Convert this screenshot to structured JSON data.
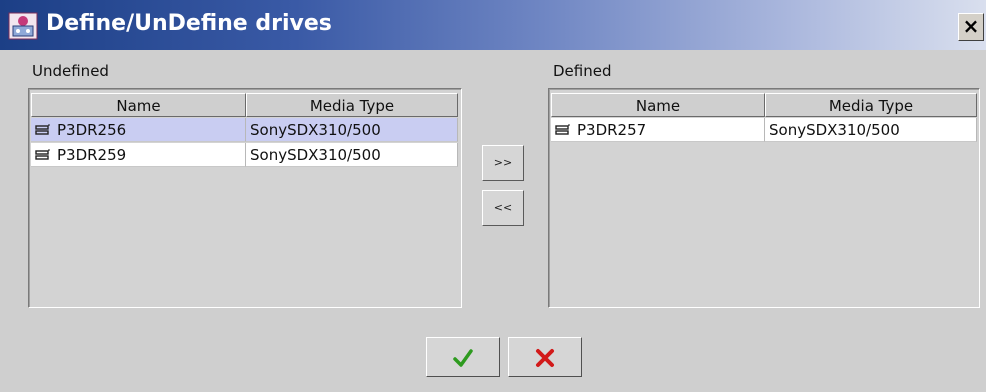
{
  "window": {
    "title": "Define/UnDefine drives",
    "close_label": "×"
  },
  "undefined": {
    "label": "Undefined",
    "columns": [
      "Name",
      "Media Type"
    ],
    "rows": [
      {
        "name": "P3DR256",
        "media": "SonySDX310/500",
        "selected": true,
        "icon": "tape-drive-icon"
      },
      {
        "name": "P3DR259",
        "media": "SonySDX310/500",
        "selected": false,
        "icon": "tape-drive-icon"
      }
    ]
  },
  "defined": {
    "label": "Defined",
    "columns": [
      "Name",
      "Media Type"
    ],
    "rows": [
      {
        "name": "P3DR257",
        "media": "SonySDX310/500",
        "selected": false,
        "icon": "tape-drive-icon"
      }
    ]
  },
  "transfer": {
    "move_right_label": ">>",
    "move_left_label": "<<"
  },
  "actions": {
    "ok_icon": "checkmark-icon",
    "cancel_icon": "x-icon",
    "ok_color": "#2e9b1f",
    "cancel_color": "#d21a1a"
  },
  "colors": {
    "title_gradient_start": "#1c3f86",
    "selected_row": "#c9cdf2"
  }
}
